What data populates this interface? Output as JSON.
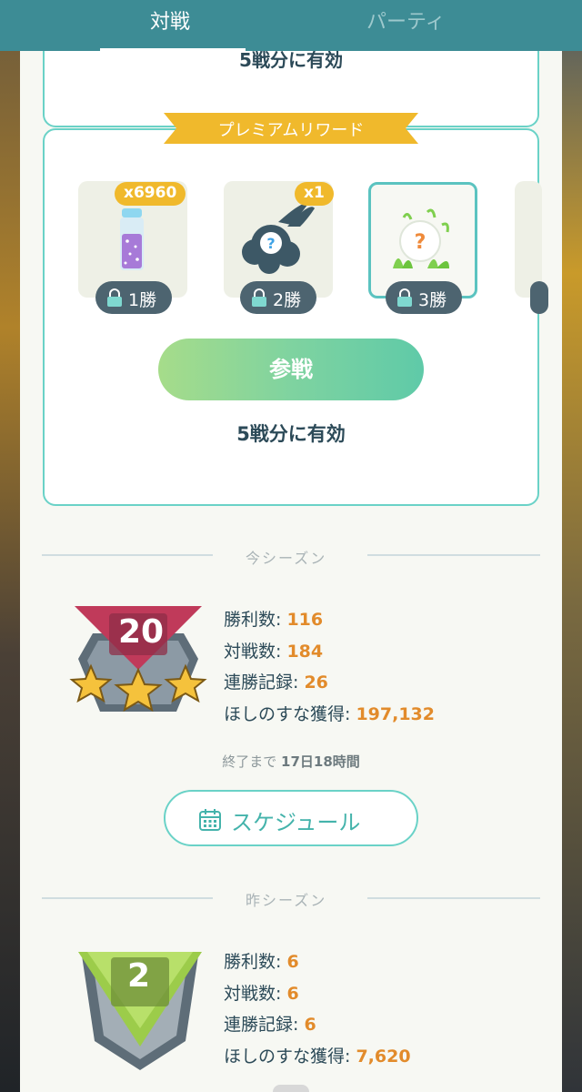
{
  "tabs": {
    "battle": "対戦",
    "party": "パーティ"
  },
  "top_card": {
    "validity": "5戦分に有効"
  },
  "premium": {
    "ribbon": "プレミアムリワード",
    "rewards": [
      {
        "quantity": "x6960",
        "icon": "stardust-vial-icon",
        "wins": "1勝"
      },
      {
        "quantity": "x1",
        "icon": "mystery-smoke-icon",
        "wins": "2勝"
      },
      {
        "quantity": "",
        "icon": "mystery-encounter-icon",
        "wins": "3勝"
      },
      {
        "quantity": "",
        "icon": "",
        "wins": ""
      }
    ],
    "join_label": "参戦",
    "validity": "5戦分に有効"
  },
  "current_season": {
    "label": "今シーズン",
    "rank": "20",
    "stats": [
      {
        "key": "勝利数: ",
        "value": "116"
      },
      {
        "key": "対戦数: ",
        "value": "184"
      },
      {
        "key": "連勝記録: ",
        "value": "26"
      },
      {
        "key": "ほしのすな獲得: ",
        "value": "197,132"
      }
    ],
    "end_prefix": "終了まで",
    "end_value": "17日18時間",
    "schedule_label": "スケジュール"
  },
  "previous_season": {
    "label": "昨シーズン",
    "rank": "2",
    "stats": [
      {
        "key": "勝利数: ",
        "value": "6"
      },
      {
        "key": "対戦数: ",
        "value": "6"
      },
      {
        "key": "連勝記録: ",
        "value": "6"
      },
      {
        "key": "ほしのすな獲得: ",
        "value": "7,620"
      }
    ]
  },
  "colors": {
    "header": "#3d8c95",
    "accent_teal": "#6ad2c7",
    "gold": "#f0b92c",
    "value_orange": "#e28b2b",
    "text_dark": "#2c4a58"
  }
}
